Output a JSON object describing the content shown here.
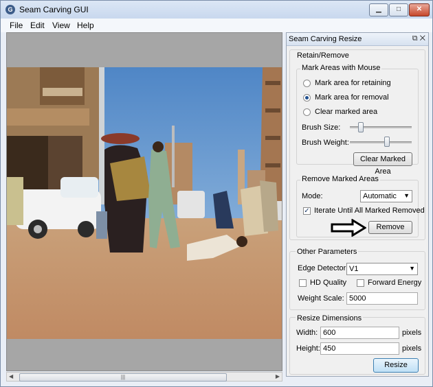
{
  "window": {
    "title": "Seam Carving GUI",
    "minimize": "▁",
    "maximize": "□",
    "close": "✕"
  },
  "menu": [
    "File",
    "Edit",
    "View",
    "Help"
  ],
  "scroll": {
    "grip": "|||",
    "left": "◀",
    "right": "▶"
  },
  "panel": {
    "title": "Seam Carving Resize",
    "retain_remove": {
      "group_label": "Retain/Remove",
      "mark_label": "Mark Areas with Mouse",
      "options": [
        "Mark area for retaining",
        "Mark area for removal",
        "Clear marked area"
      ],
      "selected_index": 1,
      "brush_size_label": "Brush Size:",
      "brush_size_level": 0.15,
      "brush_weight_label": "Brush Weight:",
      "brush_weight_level": 0.6,
      "clear_button": "Clear Marked Area"
    },
    "remove_marked": {
      "group_label": "Remove Marked Areas",
      "mode_label": "Mode:",
      "mode_value": "Automatic",
      "iterate_label": "Iterate Until All Marked Removed",
      "iterate_checked": true,
      "remove_button": "Remove"
    },
    "other": {
      "group_label": "Other Parameters",
      "edge_label": "Edge Detector:",
      "edge_value": "V1",
      "hd_label": "HD Quality",
      "forward_label": "Forward Energy",
      "weight_label": "Weight Scale:",
      "weight_value": "5000"
    },
    "resize": {
      "group_label": "Resize Dimensions",
      "width_label": "Width:",
      "width_value": "600",
      "height_label": "Height:",
      "height_value": "450",
      "unit": "pixels",
      "resize_button": "Resize"
    }
  }
}
